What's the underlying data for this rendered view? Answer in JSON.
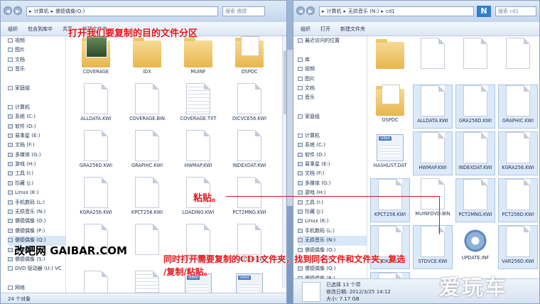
{
  "left": {
    "breadcrumb": [
      "计算机",
      "儒德偶像(Q:)"
    ],
    "search_placeholder": "搜索 儒德",
    "toolbar": [
      "组织",
      "包含到库中",
      "共享",
      "新建文件夹"
    ],
    "nav": [
      {
        "label": "视频",
        "icon": "video-library-icon"
      },
      {
        "label": "图片",
        "icon": "picture-library-icon"
      },
      {
        "label": "文档",
        "icon": "document-library-icon"
      },
      {
        "label": "音乐",
        "icon": "music-library-icon"
      },
      {
        "label": "",
        "icon": ""
      },
      {
        "label": "家庭组",
        "icon": "homegroup-icon"
      },
      {
        "label": "",
        "icon": ""
      },
      {
        "label": "计算机",
        "icon": "computer-icon"
      },
      {
        "label": "系统 (C:)",
        "icon": "drive-icon"
      },
      {
        "label": "软件 (D:)",
        "icon": "drive-icon"
      },
      {
        "label": "易事星 (E:)",
        "icon": "drive-icon"
      },
      {
        "label": "文档 (F:)",
        "icon": "drive-icon"
      },
      {
        "label": "多媒体 (G:)",
        "icon": "drive-icon"
      },
      {
        "label": "游戏 (H:)",
        "icon": "drive-icon"
      },
      {
        "label": "工具 (I:)",
        "icon": "drive-icon"
      },
      {
        "label": "珍藏 (J:)",
        "icon": "drive-icon"
      },
      {
        "label": "Linux (K:)",
        "icon": "drive-icon"
      },
      {
        "label": "手机数码 (L:)",
        "icon": "drive-icon"
      },
      {
        "label": "无损音乐 (N:)",
        "icon": "drive-icon"
      },
      {
        "label": "儒德偶像 (O:)",
        "icon": "drive-icon"
      },
      {
        "label": "儒德偶像 (P:)",
        "icon": "drive-icon"
      },
      {
        "label": "儒德偶像 (Q:)",
        "icon": "drive-icon",
        "selected": true
      },
      {
        "label": "儒德偶像 (R:)",
        "icon": "drive-icon"
      },
      {
        "label": "儒德偶像 (S:)",
        "icon": "drive-icon"
      },
      {
        "label": "DVD 驱动器 (U:) VC",
        "icon": "dvd-drive-icon"
      },
      {
        "label": "",
        "icon": ""
      },
      {
        "label": "网络",
        "icon": "network-icon"
      }
    ],
    "files": [
      {
        "name": "COVERAGE",
        "type": "folder-photo"
      },
      {
        "name": "IDX",
        "type": "folder"
      },
      {
        "name": "MUINF",
        "type": "folder"
      },
      {
        "name": "OSPDC",
        "type": "folder-paper"
      },
      {
        "name": "ALLDATA.KWI",
        "type": "doc"
      },
      {
        "name": "COVERAGE.BIN",
        "type": "doc"
      },
      {
        "name": "COVERAGE.TXT",
        "type": "doc-lines"
      },
      {
        "name": "DICVCE56.KWI",
        "type": "doc"
      },
      {
        "name": "GRA256D.KWI",
        "type": "doc"
      },
      {
        "name": "GRAPHIC.KWI",
        "type": "doc"
      },
      {
        "name": "HWMAP.KWI",
        "type": "doc"
      },
      {
        "name": "INDEXDAT.KWI",
        "type": "doc"
      },
      {
        "name": "KGRA256.KWI",
        "type": "doc"
      },
      {
        "name": "KPCT256.KWI",
        "type": "doc"
      },
      {
        "name": "LOADING.KWI",
        "type": "doc"
      },
      {
        "name": "PCT2MNG.KWI",
        "type": "doc"
      },
      {
        "name": "",
        "type": "doc"
      },
      {
        "name": "",
        "type": "doc"
      },
      {
        "name": "STDVCE.KWI",
        "type": "doc"
      },
      {
        "name": "VAR256D.KWI",
        "type": "doc"
      },
      {
        "name": "VARPARA.KWI",
        "type": "doc"
      },
      {
        "name": "VERSION.TXT",
        "type": "doc-lines"
      },
      {
        "name": "VIRTUAL0.DAT",
        "type": "video"
      },
      {
        "name": "VIRTUAL1.DAT",
        "type": "video"
      }
    ],
    "status_text": "24 个对象"
  },
  "right": {
    "breadcrumb": [
      "计算机",
      "无损音乐 (N:)",
      "cd1"
    ],
    "search_placeholder": "搜索 cd1",
    "toolbar": [
      "组织",
      "打开",
      "新建文件夹"
    ],
    "nav": [
      {
        "label": "最近访问的位置",
        "icon": "recent-places-icon"
      },
      {
        "label": "",
        "icon": ""
      },
      {
        "label": "库",
        "icon": "library-icon"
      },
      {
        "label": "视频",
        "icon": "video-library-icon"
      },
      {
        "label": "图片",
        "icon": "picture-library-icon"
      },
      {
        "label": "文档",
        "icon": "document-library-icon"
      },
      {
        "label": "音乐",
        "icon": "music-library-icon"
      },
      {
        "label": "",
        "icon": ""
      },
      {
        "label": "家庭组",
        "icon": "homegroup-icon"
      },
      {
        "label": "",
        "icon": ""
      },
      {
        "label": "计算机",
        "icon": "computer-icon"
      },
      {
        "label": "系统 (C:)",
        "icon": "drive-icon"
      },
      {
        "label": "软件 (D:)",
        "icon": "drive-icon"
      },
      {
        "label": "易事星 (E:)",
        "icon": "drive-icon"
      },
      {
        "label": "文档 (F:)",
        "icon": "drive-icon"
      },
      {
        "label": "多媒体 (G:)",
        "icon": "drive-icon"
      },
      {
        "label": "游戏 (H:)",
        "icon": "drive-icon"
      },
      {
        "label": "工具 (I:)",
        "icon": "drive-icon"
      },
      {
        "label": "珍藏 (J:)",
        "icon": "drive-icon"
      },
      {
        "label": "Linux (K:)",
        "icon": "drive-icon"
      },
      {
        "label": "手机数码 (L:)",
        "icon": "drive-icon"
      },
      {
        "label": "无损音乐 (N:)",
        "icon": "drive-icon",
        "selected": true
      },
      {
        "label": "儒德偶像 (O:)",
        "icon": "drive-icon"
      },
      {
        "label": "儒德偶像 (P:)",
        "icon": "drive-icon"
      },
      {
        "label": "儒德偶像 (Q:)",
        "icon": "drive-icon"
      },
      {
        "label": "儒德偶像 (R:)",
        "icon": "drive-icon"
      },
      {
        "label": "儒德偶像 (S:)",
        "icon": "drive-icon"
      }
    ],
    "files": [
      {
        "name": "",
        "type": "folder"
      },
      {
        "name": "",
        "type": "doc"
      },
      {
        "name": "",
        "type": "doc"
      },
      {
        "name": "",
        "type": "doc"
      },
      {
        "name": "OSPDC",
        "type": "folder-paper"
      },
      {
        "name": "ALLDATA.KWI",
        "type": "doc",
        "sel": true
      },
      {
        "name": "GRA256D.KWI",
        "type": "doc",
        "sel": true
      },
      {
        "name": "GRAPHIC.KWI",
        "type": "doc",
        "sel": true
      },
      {
        "name": "HASHLIST.DAT",
        "type": "video"
      },
      {
        "name": "HWMAP.KWI",
        "type": "doc",
        "sel": true
      },
      {
        "name": "INDEXDAT.KWI",
        "type": "doc",
        "sel": true
      },
      {
        "name": "KGRA256.KWI",
        "type": "doc",
        "sel": true
      },
      {
        "name": "KPCT256.KWI",
        "type": "doc",
        "sel": true
      },
      {
        "name": "MUINFDVD.BIN",
        "type": "doc"
      },
      {
        "name": "PCT2MNG.KWI",
        "type": "doc",
        "sel": true
      },
      {
        "name": "PCT256D.KWI",
        "type": "doc",
        "sel": true
      },
      {
        "name": "STDKIR.KWI",
        "type": "doc",
        "sel": true
      },
      {
        "name": "STDVCE.KWI",
        "type": "doc",
        "sel": true
      },
      {
        "name": "UPDATE.INF",
        "type": "gear"
      },
      {
        "name": "VAR256D.KWI",
        "type": "doc",
        "sel": true
      },
      {
        "name": "VARPARA.KWI",
        "type": "doc",
        "sel": true
      }
    ],
    "status_line1": "已选择 13 个项",
    "status_line2": "修改日期: 2012/3/25 14:12",
    "status_line3": "大小: 7.17 GB"
  },
  "annotations": {
    "top": "打开我们要复制的目的文件分区",
    "paste": "粘贴。",
    "bottom1": "同时打开需要复制的CD1文件夹，找到同名文件和文件夹，复选",
    "bottom2": "/复制/粘贴。"
  },
  "watermark": {
    "left": "改吧网 GAIBAR.COM",
    "right": "爱玩车"
  },
  "badge": "N"
}
